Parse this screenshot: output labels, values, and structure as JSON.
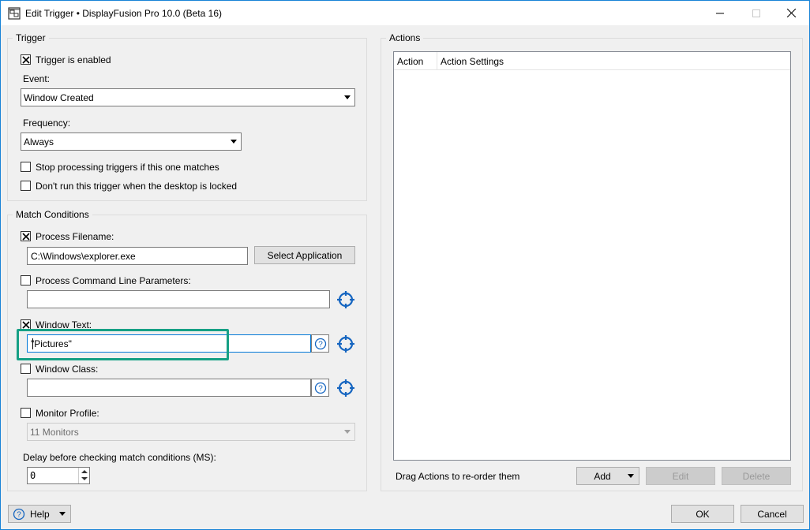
{
  "window": {
    "title": "Edit Trigger • DisplayFusion Pro 10.0 (Beta 16)",
    "accent_color": "#1883d7"
  },
  "trigger": {
    "group_title": "Trigger",
    "enabled": {
      "label": "Trigger is enabled",
      "checked": true
    },
    "event": {
      "label": "Event:",
      "value": "Window Created"
    },
    "frequency": {
      "label": "Frequency:",
      "value": "Always"
    },
    "stop_processing": {
      "label": "Stop processing triggers if this one matches",
      "checked": false
    },
    "dont_run_locked": {
      "label": "Don't run this trigger when the desktop is locked",
      "checked": false
    }
  },
  "match": {
    "group_title": "Match Conditions",
    "process_filename": {
      "label": "Process Filename:",
      "checked": true,
      "value": "C:\\Windows\\explorer.exe",
      "select_button": "Select Application"
    },
    "process_cmdline": {
      "label": "Process Command Line Parameters:",
      "checked": false,
      "value": ""
    },
    "window_text": {
      "label": "Window Text:",
      "checked": true,
      "value": "\"Pictures\""
    },
    "window_class": {
      "label": "Window Class:",
      "checked": false,
      "value": ""
    },
    "monitor_profile": {
      "label": "Monitor Profile:",
      "checked": false,
      "value": "11 Monitors"
    },
    "delay": {
      "label": "Delay before checking match conditions (MS):",
      "value": "0"
    },
    "highlight_color": "#16a085"
  },
  "actions": {
    "group_title": "Actions",
    "columns": [
      "Action",
      "Action Settings"
    ],
    "hint": "Drag Actions to re-order them",
    "add_label": "Add",
    "edit_label": "Edit",
    "delete_label": "Delete"
  },
  "footer": {
    "help_label": "Help",
    "ok_label": "OK",
    "cancel_label": "Cancel"
  },
  "icons": {
    "app": "displayfusion-icon",
    "crosshair": "crosshair-icon",
    "help": "question-circle-icon",
    "crosshair_color": "#1565c0"
  }
}
